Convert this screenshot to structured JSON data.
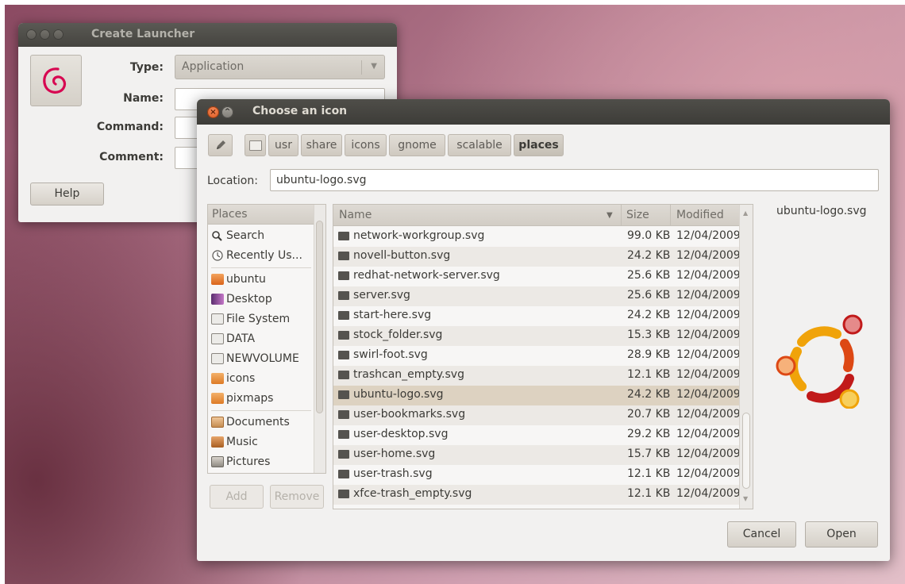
{
  "launcher": {
    "title": "Create Launcher",
    "type_label": "Type:",
    "type_value": "Application",
    "name_label": "Name:",
    "command_label": "Command:",
    "comment_label": "Comment:",
    "help_button": "Help"
  },
  "chooser": {
    "title": "Choose an icon",
    "path_crumbs": [
      "usr",
      "share",
      "icons",
      "gnome",
      "scalable",
      "places"
    ],
    "active_crumb": "places",
    "location_label": "Location:",
    "location_value": "ubuntu-logo.svg",
    "places_header": "Places",
    "places": [
      {
        "label": "Search",
        "icon": "search-icon"
      },
      {
        "label": "Recently Us...",
        "icon": "recent-icon"
      },
      {
        "label": "ubuntu",
        "icon": "home-folder-icon"
      },
      {
        "label": "Desktop",
        "icon": "desktop-icon"
      },
      {
        "label": "File System",
        "icon": "drive-icon"
      },
      {
        "label": "DATA",
        "icon": "drive-icon"
      },
      {
        "label": "NEWVOLUME",
        "icon": "drive-icon"
      },
      {
        "label": "icons",
        "icon": "folder-icon"
      },
      {
        "label": "pixmaps",
        "icon": "folder-icon"
      },
      {
        "label": "Documents",
        "icon": "documents-folder-icon"
      },
      {
        "label": "Music",
        "icon": "music-folder-icon"
      },
      {
        "label": "Pictures",
        "icon": "pictures-folder-icon"
      }
    ],
    "add_button": "Add",
    "remove_button": "Remove",
    "columns": {
      "name": "Name",
      "size": "Size",
      "modified": "Modified"
    },
    "files": [
      {
        "name": "network-workgroup.svg",
        "size": "99.0 KB",
        "modified": "12/04/2009"
      },
      {
        "name": "novell-button.svg",
        "size": "24.2 KB",
        "modified": "12/04/2009"
      },
      {
        "name": "redhat-network-server.svg",
        "size": "25.6 KB",
        "modified": "12/04/2009"
      },
      {
        "name": "server.svg",
        "size": "25.6 KB",
        "modified": "12/04/2009"
      },
      {
        "name": "start-here.svg",
        "size": "24.2 KB",
        "modified": "12/04/2009"
      },
      {
        "name": "stock_folder.svg",
        "size": "15.3 KB",
        "modified": "12/04/2009"
      },
      {
        "name": "swirl-foot.svg",
        "size": "28.9 KB",
        "modified": "12/04/2009"
      },
      {
        "name": "trashcan_empty.svg",
        "size": "12.1 KB",
        "modified": "12/04/2009"
      },
      {
        "name": "ubuntu-logo.svg",
        "size": "24.2 KB",
        "modified": "12/04/2009"
      },
      {
        "name": "user-bookmarks.svg",
        "size": "20.7 KB",
        "modified": "12/04/2009"
      },
      {
        "name": "user-desktop.svg",
        "size": "29.2 KB",
        "modified": "12/04/2009"
      },
      {
        "name": "user-home.svg",
        "size": "15.7 KB",
        "modified": "12/04/2009"
      },
      {
        "name": "user-trash.svg",
        "size": "12.1 KB",
        "modified": "12/04/2009"
      },
      {
        "name": "xfce-trash_empty.svg",
        "size": "12.1 KB",
        "modified": "12/04/2009"
      }
    ],
    "selected_file": "ubuntu-logo.svg",
    "preview_label": "ubuntu-logo.svg",
    "cancel_button": "Cancel",
    "open_button": "Open"
  },
  "colors": {
    "ubuntu_orange": "#dd4814",
    "ubuntu_yellow": "#f0a30a",
    "ubuntu_red": "#c11a1a",
    "debian_red": "#d70751",
    "selection": "#ddd2c1"
  }
}
